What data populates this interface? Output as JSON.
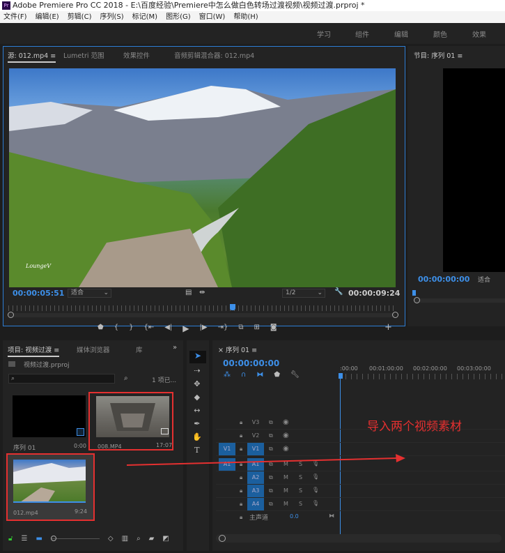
{
  "window": {
    "title": "Adobe Premiere Pro CC 2018 - E:\\百度经验\\Premiere中怎么做白色转场过渡视频\\视频过渡.prproj *",
    "logo": "Pr"
  },
  "menu": [
    "文件(F)",
    "编辑(E)",
    "剪辑(C)",
    "序列(S)",
    "标记(M)",
    "图形(G)",
    "窗口(W)",
    "帮助(H)"
  ],
  "workspaces": [
    "学习",
    "组件",
    "编辑",
    "颜色",
    "效果"
  ],
  "source": {
    "tabs": [
      "源: 012.mp4",
      "Lumetri 范围",
      "效果控件",
      "音频剪辑混合器: 012.mp4"
    ],
    "timecode": "00:00:05:51",
    "fit": "适合",
    "resolution": "1/2",
    "duration": "00:00:09:24",
    "watermark": "LoungeV",
    "playhead_fraction": 0.58
  },
  "program": {
    "title": "节目: 序列 01",
    "timecode": "00:00:00:00",
    "fit": "适合"
  },
  "project": {
    "tabs": [
      "项目: 视频过渡",
      "媒体浏览器",
      "库"
    ],
    "file": "视频过渡.prproj",
    "search_placeholder": "",
    "count": "1 项已...",
    "items": [
      {
        "name": "序列 01",
        "duration": "0:00"
      },
      {
        "name": "008.MP4",
        "duration": "17:07"
      },
      {
        "name": "012.mp4",
        "duration": "9:24"
      }
    ]
  },
  "timeline": {
    "tab": "序列 01",
    "timecode": "00:00:00:00",
    "ruler": [
      ":00:00",
      "00:01:00:00",
      "00:02:00:00",
      "00:03:00:00"
    ],
    "video_tracks": [
      "V3",
      "V2",
      "V1"
    ],
    "audio_tracks": [
      "A1",
      "A2",
      "A3",
      "A4"
    ],
    "source_v": "V1",
    "source_a": "A1",
    "mute": "M",
    "solo": "S",
    "master": "主声道",
    "master_value": "0.0"
  },
  "annotation": {
    "text": "导入两个视频素材",
    "color": "#e53030"
  },
  "colors": {
    "accent": "#3d8fe8",
    "highlight": "#e53030"
  }
}
